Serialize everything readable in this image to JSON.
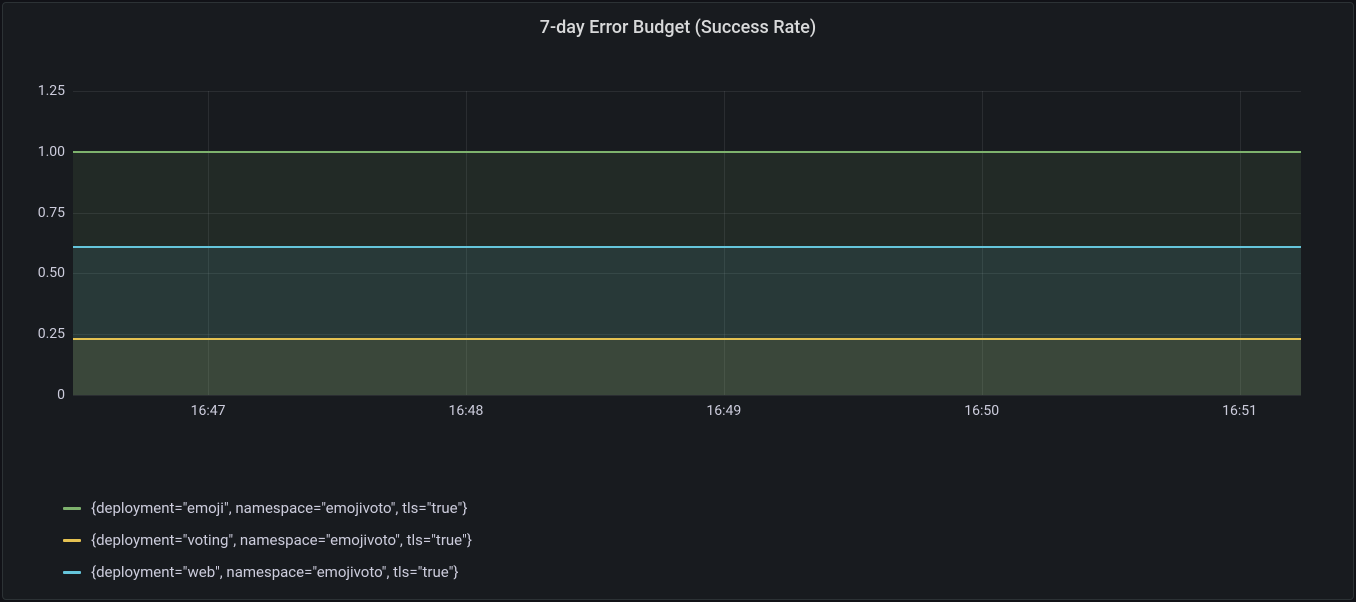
{
  "chart_data": {
    "type": "line",
    "title": "7-day Error Budget (Success Rate)",
    "xlabel": "",
    "ylabel": "",
    "x": [
      "16:47",
      "16:48",
      "16:49",
      "16:50",
      "16:51"
    ],
    "ylim": [
      0,
      1.25
    ],
    "y_ticks": [
      0,
      0.25,
      0.5,
      0.75,
      1.0,
      1.25
    ],
    "y_tick_labels": [
      "0",
      "0.25",
      "0.50",
      "0.75",
      "1.00",
      "1.25"
    ],
    "grid": true,
    "legend_position": "bottom-left",
    "series": [
      {
        "name": "{deployment=\"emoji\", namespace=\"emojivoto\", tls=\"true\"}",
        "color": "#7eb26d",
        "values": [
          1.0,
          1.0,
          1.0,
          1.0,
          1.0
        ]
      },
      {
        "name": "{deployment=\"voting\", namespace=\"emojivoto\", tls=\"true\"}",
        "color": "#e5c252",
        "values": [
          0.23,
          0.23,
          0.23,
          0.23,
          0.23
        ]
      },
      {
        "name": "{deployment=\"web\", namespace=\"emojivoto\", tls=\"true\"}",
        "color": "#65c5db",
        "values": [
          0.61,
          0.61,
          0.61,
          0.61,
          0.61
        ]
      }
    ]
  }
}
